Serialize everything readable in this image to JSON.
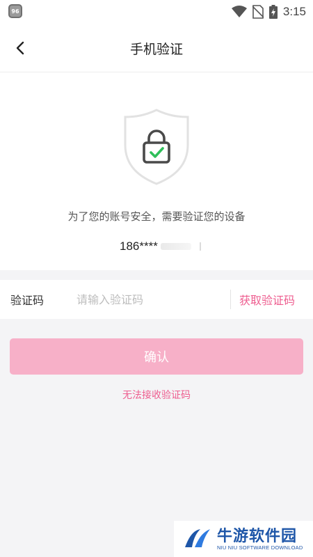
{
  "status_bar": {
    "time": "3:15",
    "icons": [
      "app-notification-icon",
      "wifi-icon",
      "no-sim-icon",
      "battery-charging-icon"
    ]
  },
  "header": {
    "title": "手机验证",
    "back_icon": "chevron-left-icon"
  },
  "verify": {
    "description": "为了您的账号安全，需要验证您的设备",
    "phone_masked": "186****",
    "icon": "shield-lock-check-icon"
  },
  "code_row": {
    "label": "验证码",
    "placeholder": "请输入验证码",
    "value": "",
    "get_code_label": "获取验证码"
  },
  "actions": {
    "confirm_label": "确认",
    "cannot_receive_label": "无法接收验证码"
  },
  "watermark": {
    "title": "牛游软件园",
    "subtitle": "NIU NIU SOFTWARE DOWNLOAD"
  },
  "colors": {
    "accent": "#ee5d8f",
    "button_disabled": "#f7b0c8",
    "background": "#f4f4f6",
    "shield_check": "#2fbf5a"
  }
}
